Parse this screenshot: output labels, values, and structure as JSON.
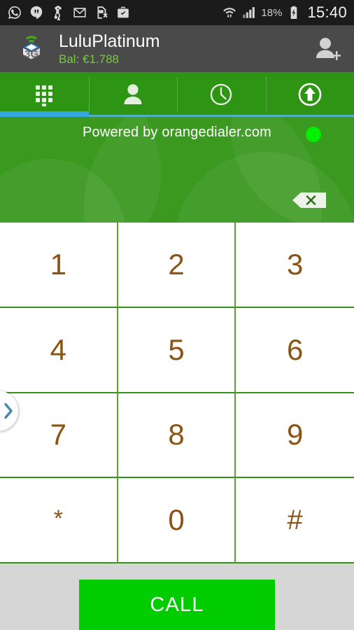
{
  "status_bar": {
    "notification_icons": [
      {
        "name": "whatsapp-icon",
        "label": "WhatsApp"
      },
      {
        "name": "hangouts-icon",
        "label": "Hangouts"
      },
      {
        "name": "usb-icon",
        "label": "USB"
      },
      {
        "name": "gmail-icon",
        "label": "Gmail"
      },
      {
        "name": "sim-removed-icon",
        "label": "SIM removed"
      },
      {
        "name": "work-briefcase-icon",
        "label": "Work profile"
      }
    ],
    "wifi_icon": "wifi-transfer-icon",
    "signal_icon": "cell-signal-icon",
    "battery_percent": "18%",
    "battery_icon": "battery-charging-icon",
    "clock": "15:40"
  },
  "app_bar": {
    "logo_icon": "3g-logo-icon",
    "account_name": "LuluPlatinum",
    "balance": "Bal: €1.788",
    "add_contact_icon": "add-contact-icon",
    "background_color": "#4a4a4a",
    "balance_color": "#7ac943"
  },
  "tabs": [
    {
      "id": "dialpad",
      "icon": "dialpad-icon",
      "label": "Dialpad",
      "active": true
    },
    {
      "id": "contacts",
      "icon": "contacts-icon",
      "label": "Contacts",
      "active": false
    },
    {
      "id": "history",
      "icon": "clock-icon",
      "label": "History",
      "active": false
    },
    {
      "id": "topup",
      "icon": "arrow-up-circle-icon",
      "label": "Top up",
      "active": false
    }
  ],
  "display": {
    "powered_by": "Powered by orangedialer.com",
    "status_dot_color": "#00f000",
    "status_dot_name": "connection-status-dot",
    "backspace_icon": "backspace-icon",
    "number_entry": "",
    "background_color": "#309414"
  },
  "drawer": {
    "handle_icon": "chevron-right-icon",
    "handle_color": "#3f8ba8"
  },
  "keypad": {
    "keys": [
      "1",
      "2",
      "3",
      "4",
      "5",
      "6",
      "7",
      "8",
      "9",
      "*",
      "0",
      "#"
    ],
    "digit_color": "#8a5415",
    "gridline_color": "#45981f"
  },
  "footer": {
    "call_label": "CALL",
    "call_color": "#00cc00",
    "background_color": "#d6d6d6"
  }
}
